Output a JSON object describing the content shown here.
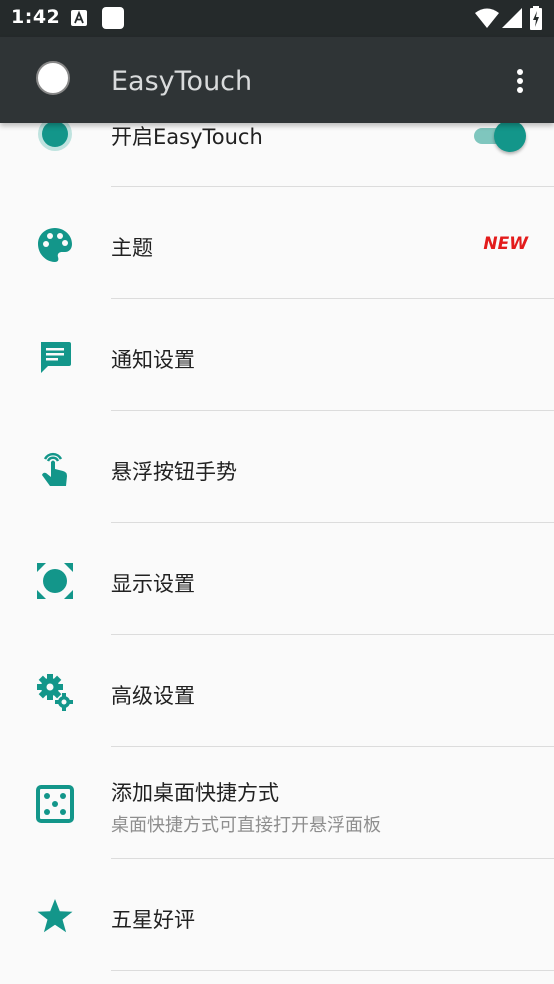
{
  "status_bar": {
    "time": "1:42"
  },
  "toolbar": {
    "title": "EasyTouch",
    "overflow_icon": "more-vert-icon"
  },
  "colors": {
    "accent": "#13968a",
    "toolbar": "#2f3436",
    "status_bar": "#252a2b",
    "new_badge": "#e31b1b"
  },
  "settings": {
    "enable": {
      "label": "开启EasyTouch",
      "icon": "enable-dot-icon",
      "switch_on": true
    },
    "theme": {
      "label": "主题",
      "badge": "NEW",
      "icon": "palette-icon"
    },
    "notification": {
      "label": "通知设置",
      "icon": "message-icon"
    },
    "gesture": {
      "label": "悬浮按钮手势",
      "icon": "touch-gesture-icon"
    },
    "display": {
      "label": "显示设置",
      "icon": "display-focus-icon"
    },
    "advanced": {
      "label": "高级设置",
      "icon": "gears-icon"
    },
    "shortcut": {
      "label": "添加桌面快捷方式",
      "sublabel": "桌面快捷方式可直接打开悬浮面板",
      "icon": "dice-icon"
    },
    "rate": {
      "label": "五星好评",
      "icon": "star-icon"
    }
  }
}
